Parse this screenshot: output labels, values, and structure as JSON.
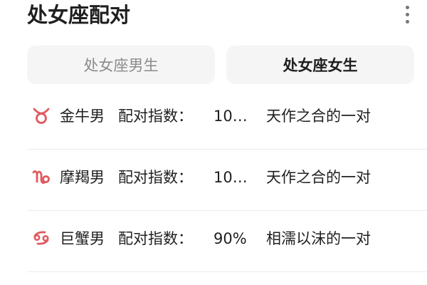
{
  "header": {
    "title": "处女座配对"
  },
  "tabs": [
    {
      "label": "处女座男生",
      "active": false
    },
    {
      "label": "处女座女生",
      "active": true
    }
  ],
  "matches": [
    {
      "icon": "taurus-icon",
      "sign": "金牛男",
      "label": "配对指数：",
      "score": "10…",
      "description": "天作之合的一对"
    },
    {
      "icon": "capricorn-icon",
      "sign": "摩羯男",
      "label": "配对指数：",
      "score": "10…",
      "description": "天作之合的一对"
    },
    {
      "icon": "cancer-icon",
      "sign": "巨蟹男",
      "label": "配对指数：",
      "score": "90%",
      "description": "相濡以沫的一对"
    }
  ],
  "colors": {
    "accent": "#e0595f",
    "tab_background": "#f5f5f5",
    "inactive_text": "#8b8b8b",
    "primary_text": "#1f1f1f"
  }
}
